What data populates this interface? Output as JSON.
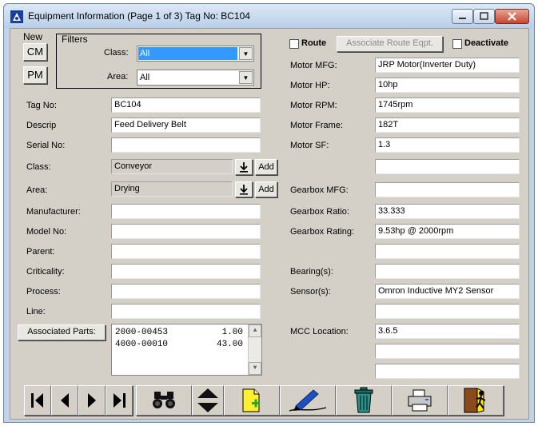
{
  "window": {
    "title": "Equipment Information (Page 1 of 3) Tag No: BC104"
  },
  "new_section": {
    "label": "New",
    "cm_label": "CM",
    "pm_label": "PM"
  },
  "filters": {
    "title": "Filters",
    "class_label": "Class:",
    "class_value": "All",
    "area_label": "Area:",
    "area_value": "All"
  },
  "left_fields": {
    "tag_no": {
      "label": "Tag No:",
      "value": "BC104"
    },
    "descrip": {
      "label": "Descrip",
      "value": "Feed Delivery Belt"
    },
    "serial_no": {
      "label": "Serial No:",
      "value": ""
    },
    "class": {
      "label": "Class:",
      "value": "Conveyor",
      "add_label": "Add"
    },
    "area": {
      "label": "Area:",
      "value": "Drying",
      "add_label": "Add"
    },
    "manufacturer": {
      "label": "Manufacturer:",
      "value": ""
    },
    "model_no": {
      "label": "Model No:",
      "value": ""
    },
    "parent": {
      "label": "Parent:",
      "value": ""
    },
    "criticality": {
      "label": "Criticality:",
      "value": ""
    },
    "process": {
      "label": "Process:",
      "value": ""
    },
    "line": {
      "label": "Line:",
      "value": ""
    }
  },
  "associated_parts": {
    "button_label": "Associated Parts:",
    "items": [
      {
        "part": "2000-00453",
        "qty": "1.00"
      },
      {
        "part": "4000-00010",
        "qty": "43.00"
      }
    ]
  },
  "route": {
    "route_label": "Route",
    "assoc_label": "Associate Route Eqpt.",
    "deactivate_label": "Deactivate"
  },
  "right_fields": {
    "motor_mfg": {
      "label": "Motor MFG:",
      "value": "JRP Motor(Inverter Duty)"
    },
    "motor_hp": {
      "label": "Motor HP:",
      "value": "10hp"
    },
    "motor_rpm": {
      "label": "Motor RPM:",
      "value": "1745rpm"
    },
    "motor_frame": {
      "label": "Motor Frame:",
      "value": "182T"
    },
    "motor_sf": {
      "label": "Motor SF:",
      "value": "1.3"
    },
    "blank1": {
      "value": ""
    },
    "gearbox_mfg": {
      "label": "Gearbox MFG:",
      "value": ""
    },
    "gearbox_ratio": {
      "label": "Gearbox Ratio:",
      "value": "33.333"
    },
    "gearbox_rating": {
      "label": "Gearbox Rating:",
      "value": "9.53hp @ 2000rpm"
    },
    "blank2": {
      "value": ""
    },
    "bearings": {
      "label": "Bearing(s):",
      "value": ""
    },
    "sensors": {
      "label": "Sensor(s):",
      "value": "Omron Inductive MY2 Sensor"
    },
    "blank3": {
      "value": ""
    },
    "mcc_location": {
      "label": "MCC Location:",
      "value": "3.6.5"
    },
    "blank4": {
      "value": ""
    },
    "blank5": {
      "value": ""
    }
  },
  "toolbar": {
    "icons": [
      "first-record-icon",
      "previous-record-icon",
      "next-record-icon",
      "last-record-icon",
      "binoculars-icon",
      "sort-icon",
      "new-record-icon",
      "edit-pen-icon",
      "trash-icon",
      "printer-icon",
      "exit-door-icon"
    ]
  },
  "colors": {
    "selection": "#3399ff",
    "client_bg": "#d4d0c8",
    "title_bar": "#c3d3e6"
  }
}
